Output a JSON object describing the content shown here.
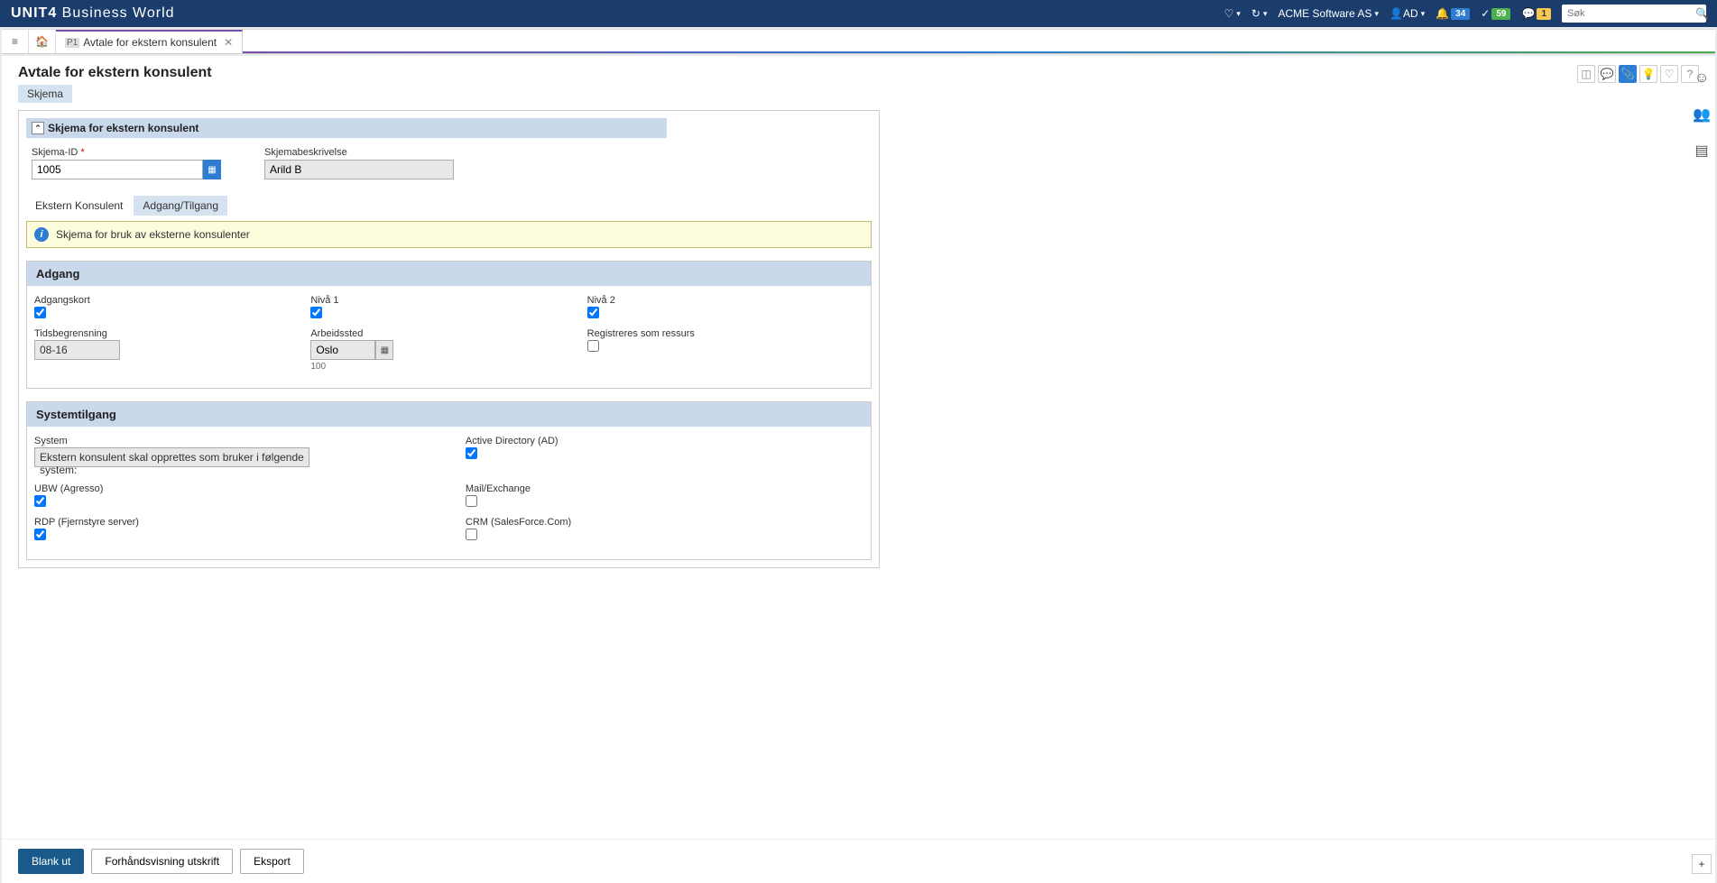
{
  "brand": {
    "bold": "UNIT4",
    "rest": " Business World"
  },
  "navbar": {
    "company": "ACME Software AS",
    "user": "AD",
    "notifications": "34",
    "tasks": "59",
    "messages": "1",
    "search_placeholder": "Søk"
  },
  "tab": {
    "prefix": "P1",
    "title": "Avtale for ekstern konsulent"
  },
  "page": {
    "title": "Avtale for ekstern konsulent",
    "subtab": "Skjema"
  },
  "section1": {
    "title": "Skjema for ekstern konsulent",
    "skjema_id_label": "Skjema-ID",
    "skjema_id_value": "1005",
    "beskrivelse_label": "Skjemabeskrivelse",
    "beskrivelse_value": "Arild B"
  },
  "subtabs": {
    "t1": "Ekstern Konsulent",
    "t2": "Adgang/Tilgang"
  },
  "info_text": "Skjema for bruk av eksterne konsulenter",
  "adgang": {
    "header": "Adgang",
    "adgangskort": "Adgangskort",
    "niva1": "Nivå 1",
    "niva2": "Nivå 2",
    "tidsbegrensning": "Tidsbegrensning",
    "tidsbegrensning_value": "08-16",
    "arbeidssted": "Arbeidssted",
    "arbeidssted_value": "Oslo",
    "arbeidssted_code": "100",
    "registreres": "Registreres som ressurs"
  },
  "system": {
    "header": "Systemtilgang",
    "system_label": "System",
    "system_value": "Ekstern konsulent skal opprettes som bruker i følgende system:",
    "ad": "Active Directory (AD)",
    "ubw": "UBW (Agresso)",
    "mail": "Mail/Exchange",
    "rdp": "RDP (Fjernstyre server)",
    "crm": "CRM (SalesForce.Com)"
  },
  "footer": {
    "blank": "Blank ut",
    "preview": "Forhåndsvisning utskrift",
    "export": "Eksport"
  }
}
